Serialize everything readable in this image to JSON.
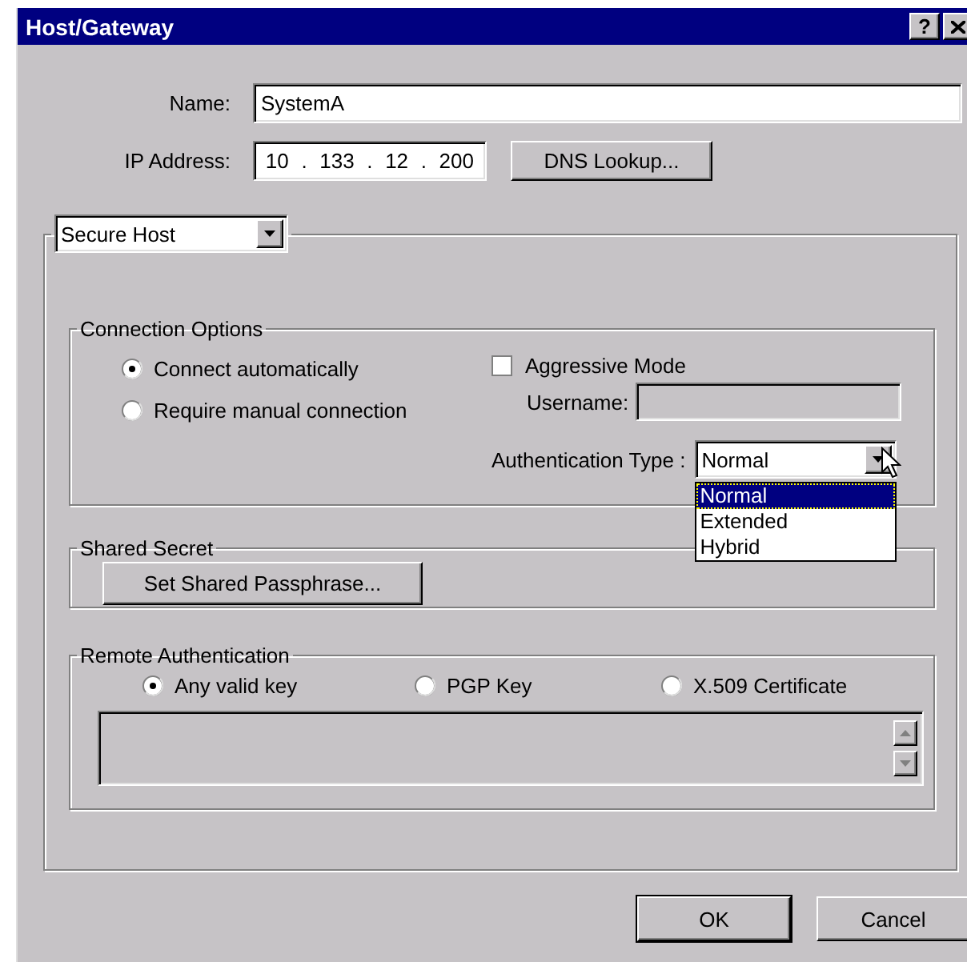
{
  "window": {
    "title": "Host/Gateway",
    "help_button": "?"
  },
  "name": {
    "label": "Name:",
    "value": "SystemA"
  },
  "ip_address": {
    "label": "IP Address:",
    "octets": [
      "10",
      "133",
      "12",
      "200"
    ],
    "separator": "."
  },
  "dns_button": "DNS Lookup...",
  "host_type": {
    "value": "Secure Host"
  },
  "connection_options": {
    "title": "Connection Options",
    "radios": [
      {
        "label": "Connect automatically",
        "selected": true
      },
      {
        "label": "Require manual connection",
        "selected": false
      }
    ],
    "aggressive_mode": {
      "label": "Aggressive Mode",
      "checked": false
    },
    "username": {
      "label": "Username:",
      "disabled": true
    },
    "authentication_type": {
      "label": "Authentication Type :",
      "value": "Normal",
      "expanded": true,
      "options": [
        {
          "label": "Normal",
          "selected": true
        },
        {
          "label": "Extended",
          "selected": false
        },
        {
          "label": "Hybrid",
          "selected": false
        }
      ]
    }
  },
  "shared_secret": {
    "title": "Shared Secret",
    "button": "Set Shared Passphrase..."
  },
  "remote_authentication": {
    "title": "Remote Authentication",
    "radios": [
      {
        "label": "Any valid key",
        "selected": true
      },
      {
        "label": "PGP Key",
        "selected": false
      },
      {
        "label": "X.509 Certificate",
        "selected": false
      }
    ],
    "key_list": {
      "disabled": true
    }
  },
  "buttons": [
    {
      "label": "OK",
      "default": true
    },
    {
      "label": "Cancel",
      "default": false
    }
  ]
}
